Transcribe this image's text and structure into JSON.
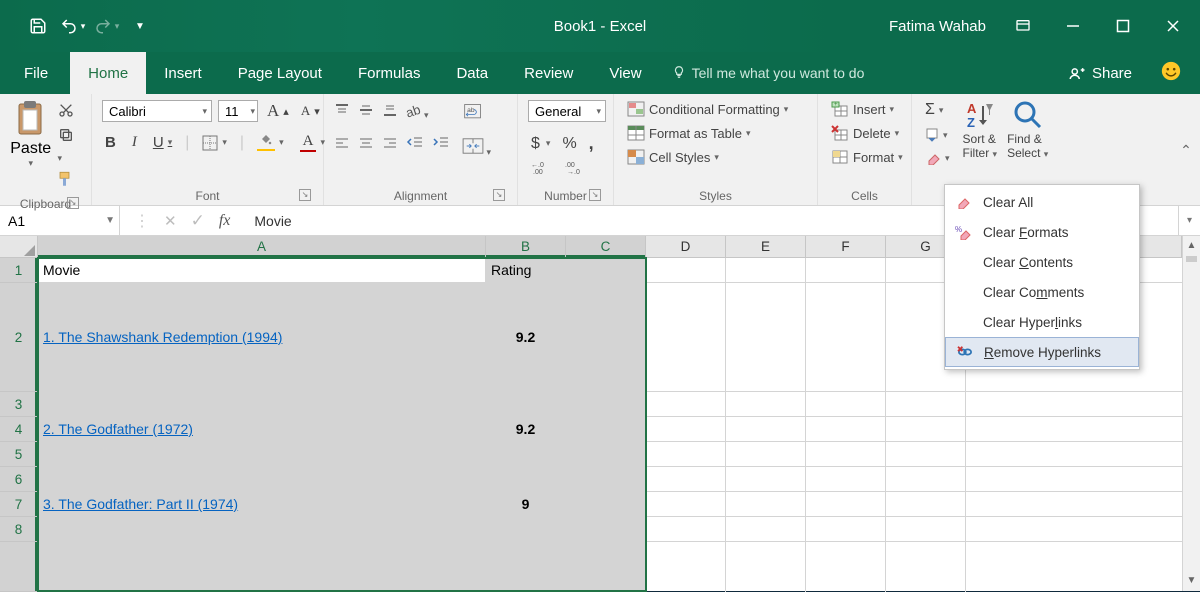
{
  "titlebar": {
    "title": "Book1  -  Excel",
    "user": "Fatima Wahab"
  },
  "tabs": {
    "file": "File",
    "home": "Home",
    "insert": "Insert",
    "pagelayout": "Page Layout",
    "formulas": "Formulas",
    "data": "Data",
    "review": "Review",
    "view": "View",
    "tellme": "Tell me what you want to do",
    "share": "Share"
  },
  "ribbon": {
    "clipboard": {
      "paste": "Paste",
      "label": "Clipboard"
    },
    "font": {
      "name": "Calibri",
      "size": "11",
      "bold": "B",
      "italic": "I",
      "underline": "U",
      "biggerA": "A",
      "smallerA": "A",
      "label": "Font"
    },
    "alignment": {
      "label": "Alignment"
    },
    "number": {
      "format": "General",
      "dollar": "$",
      "percent": "%",
      "comma": ",",
      "incdec": "←.0",
      "decdec": ".00",
      "label": "Number"
    },
    "styles": {
      "cond": "Conditional Formatting",
      "table": "Format as Table",
      "cell": "Cell Styles",
      "label": "Styles"
    },
    "cells": {
      "insert": "Insert",
      "delete": "Delete",
      "format": "Format",
      "label": "Cells"
    },
    "editing": {
      "sum": "Σ",
      "sort": "Sort &",
      "filter": "Filter",
      "find": "Find &",
      "select": "Select"
    }
  },
  "clearmenu": {
    "all": "Clear All",
    "formats": "Clear Formats",
    "contents": "Clear Contents",
    "comments": "Clear Comments",
    "hyperlinks": "Clear Hyperlinks",
    "remove": "Remove Hyperlinks"
  },
  "fx": {
    "cellref": "A1",
    "fxlabel": "fx",
    "value": "Movie"
  },
  "columns": [
    "A",
    "B",
    "C",
    "D",
    "E",
    "F",
    "G"
  ],
  "rows": [
    "1",
    "2",
    "3",
    "4",
    "5",
    "6",
    "7",
    "8"
  ],
  "data": {
    "a1": "Movie",
    "b1": "Rating",
    "a2": "1. The Shawshank Redemption (1994)",
    "b2": "9.2",
    "a4": "2. The Godfather (1972)",
    "b4": "9.2",
    "a7": "3. The Godfather: Part II (1974)",
    "b7": "9"
  }
}
